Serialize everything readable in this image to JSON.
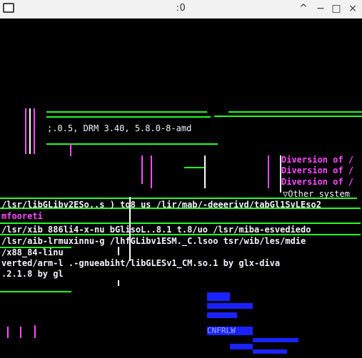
{
  "window": {
    "title": ":0",
    "controls": [
      "^",
      "−",
      "□",
      "×"
    ]
  },
  "screen": {
    "version_fragment": ";.0.5, DRM 3.40, 5.8.0-8-amd",
    "diversion_lines": [
      "Diversion of /",
      "Diversion of /",
      "Diversion of /"
    ],
    "other_system": "Other system",
    "log_lines": [
      "/lsr/libGLibv2ESo..s  ) to8 us /lir/mab/-deeerivd/tabGl1SvLEso2",
      "mfooreti",
      "/lsr/xib 886li4-x-nu  bGlisoL..8.1 t.8/uo /lsr/miba-esvediedo",
      "/lsr/aib-lrmuxinnu-g  /lhfGLibv1ESM._C.lsoo  tsr/wib/les/mdie",
      "/x88_84-linu",
      "verted/arm-l  .-gnueabiht/libGLESv1_CM.so.1 by glx-diva",
      ".2.1.8 by gl"
    ],
    "bottom_labels": [
      "CNFRLW"
    ]
  }
}
